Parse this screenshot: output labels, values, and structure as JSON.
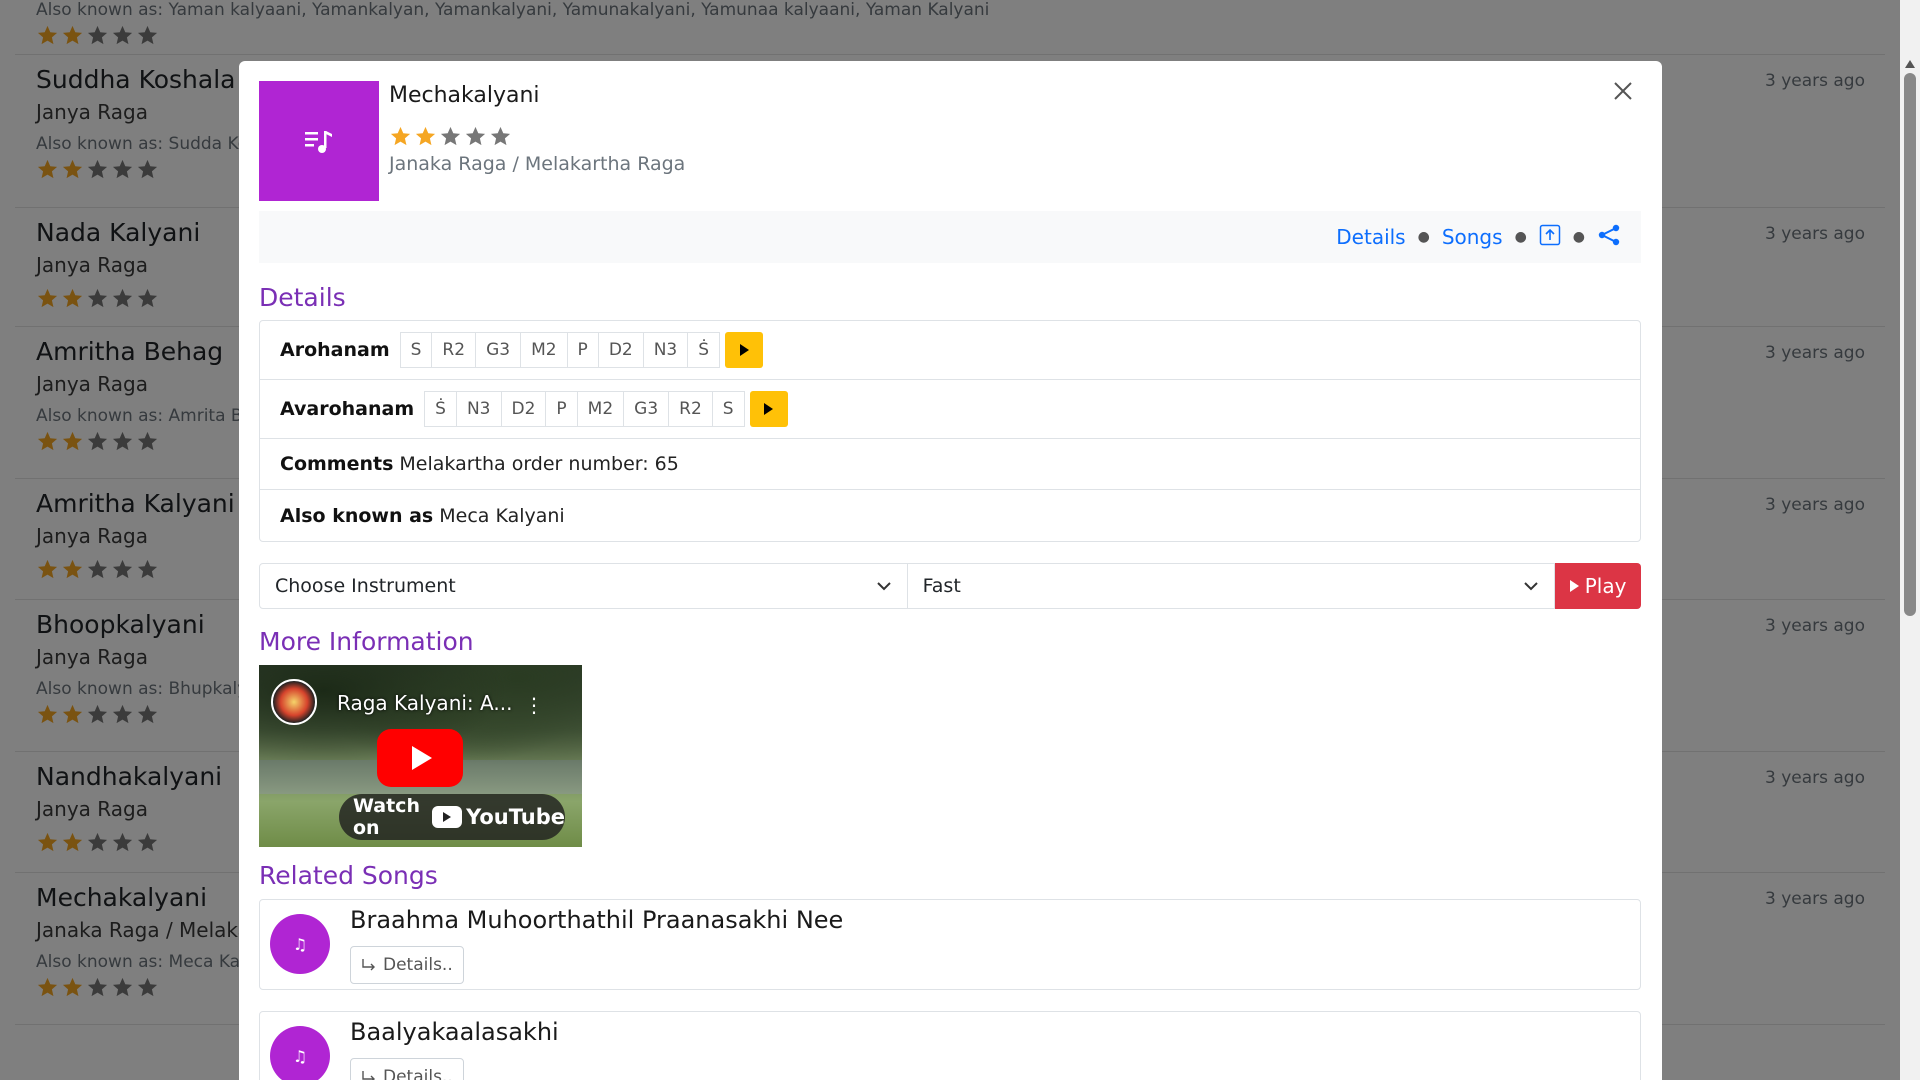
{
  "background": {
    "items": [
      {
        "name": "",
        "type": "",
        "aka": "Also known as: Yaman kalyaani, Yamankalyan, Yamankalyani, Yamunakalyani, Yamunaa kalyaani, Yaman Kalyani",
        "ago": "",
        "rating": 2
      },
      {
        "name": "Suddha Koshala",
        "type": "Janya Raga",
        "aka": "Also known as: Sudda Kosl",
        "ago": "3 years ago",
        "rating": 2
      },
      {
        "name": "Nada Kalyani",
        "type": "Janya Raga",
        "aka": "",
        "ago": "3 years ago",
        "rating": 2
      },
      {
        "name": "Amritha Behag",
        "type": "Janya Raga",
        "aka": "Also known as: Amrita Beh",
        "ago": "3 years ago",
        "rating": 2
      },
      {
        "name": "Amritha Kalyani",
        "type": "Janya Raga",
        "aka": "",
        "ago": "3 years ago",
        "rating": 2
      },
      {
        "name": "Bhoopkalyani",
        "type": "Janya Raga",
        "aka": "Also known as: Bhupkalyar",
        "ago": "3 years ago",
        "rating": 2
      },
      {
        "name": "Nandhakalyani",
        "type": "Janya Raga",
        "aka": "",
        "ago": "3 years ago",
        "rating": 2
      },
      {
        "name": "Mechakalyani",
        "type": "Janaka Raga / Melakart",
        "aka": "Also known as: Meca Kalya",
        "ago": "3 years ago",
        "rating": 2
      }
    ]
  },
  "modal": {
    "title": "Mechakalyani",
    "rating": 2,
    "rating_max": 5,
    "type": "Janaka Raga / Melakartha Raga",
    "links": {
      "details": "Details",
      "songs": "Songs"
    },
    "icons": {
      "head": "music-list-icon",
      "close": "close-icon",
      "upload": "upload-icon",
      "share": "share-icon"
    },
    "details_title": "Details",
    "arohanam_label": "Arohanam",
    "arohanam": [
      "S",
      "R2",
      "G3",
      "M2",
      "P",
      "D2",
      "N3",
      "Ṡ"
    ],
    "avarohanam_label": "Avarohanam",
    "avarohanam": [
      "Ṡ",
      "N3",
      "D2",
      "P",
      "M2",
      "G3",
      "R2",
      "S"
    ],
    "comments_label": "Comments",
    "comments_value": "Melakartha order number: 65",
    "aka_label": "Also known as",
    "aka_value": "Meca Kalyani",
    "instrument_select": "Choose Instrument",
    "speed_select": "Fast",
    "play_label": "Play",
    "more_info_title": "More Information",
    "video": {
      "title": "Raga Kalyani: A...",
      "watch_on": "Watch on",
      "brand": "YouTube"
    },
    "related_title": "Related Songs",
    "songs": [
      {
        "title": "Braahma Muhoorthathil Praanasakhi Nee",
        "details": "Details.."
      },
      {
        "title": "Baalyakaalasakhi",
        "details": "Details.."
      }
    ]
  },
  "colors": {
    "accent": "#7a2fb5",
    "icon_bg": "#b025d3",
    "play": "#dc3545",
    "scale_play": "#ffc107",
    "link": "#0d6efd",
    "star": "#f5a623"
  }
}
